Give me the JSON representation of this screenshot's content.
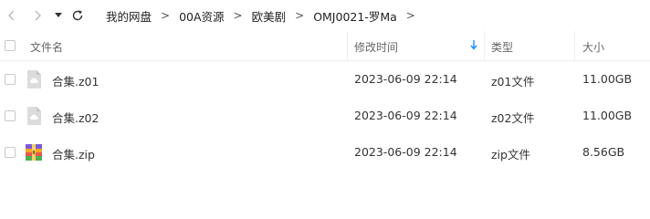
{
  "breadcrumb": [
    "我的网盘",
    "00A资源",
    "欧美剧",
    "OMJ0021-罗Ma"
  ],
  "table": {
    "columns": {
      "name": "文件名",
      "modified": "修改时间",
      "type": "类型",
      "size": "大小"
    },
    "sort_indicator": "down-arrow-icon",
    "rows": [
      {
        "name": "合集.z01",
        "modified": "2023-06-09 22:14",
        "type": "z01文件",
        "size": "11.00GB",
        "icon": "cloud-file-icon"
      },
      {
        "name": "合集.z02",
        "modified": "2023-06-09 22:14",
        "type": "z02文件",
        "size": "11.00GB",
        "icon": "cloud-file-icon"
      },
      {
        "name": "合集.zip",
        "modified": "2023-06-09 22:14",
        "type": "zip文件",
        "size": "8.56GB",
        "icon": "zip-archive-icon"
      }
    ]
  },
  "colors": {
    "accent": "#1a8cff",
    "header_text": "#666666",
    "row_text": "#333333"
  }
}
